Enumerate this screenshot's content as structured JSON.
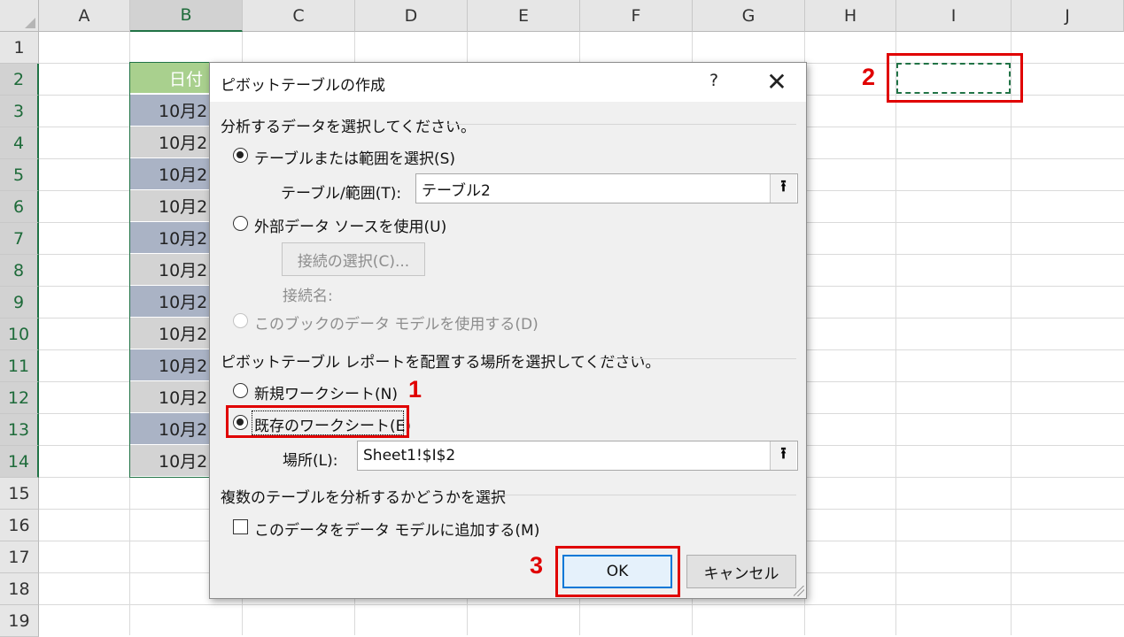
{
  "sheet": {
    "columns": [
      "A",
      "B",
      "C",
      "D",
      "E",
      "F",
      "G",
      "H",
      "I",
      "J"
    ],
    "rows": [
      "1",
      "2",
      "3",
      "4",
      "5",
      "6",
      "7",
      "8",
      "9",
      "10",
      "11",
      "12",
      "13",
      "14",
      "15",
      "16",
      "17",
      "18",
      "19"
    ],
    "table_header": "日付",
    "table_cells": [
      "10月2",
      "10月2",
      "10月2",
      "10月2",
      "10月2",
      "10月2",
      "10月2",
      "10月2",
      "10月2",
      "10月2",
      "10月2",
      "10月2"
    ]
  },
  "dialog": {
    "title": "ピボットテーブルの作成",
    "help_label": "?",
    "close_label": "✕",
    "section1": "分析するデータを選択してください。",
    "opt_table": "テーブルまたは範囲を選択(S)",
    "table_range_label": "テーブル/範囲(T):",
    "table_range_value": "テーブル2",
    "opt_external": "外部データ ソースを使用(U)",
    "connection_button": "接続の選択(C)...",
    "connection_name_label": "接続名:",
    "opt_data_model": "このブックのデータ モデルを使用する(D)",
    "section2": "ピボットテーブル レポートを配置する場所を選択してください。",
    "opt_new_sheet": "新規ワークシート(N)",
    "opt_existing_sheet": "既存のワークシート(E)",
    "location_label": "場所(L):",
    "location_value": "Sheet1!$I$2",
    "section3": "複数のテーブルを分析するかどうかを選択",
    "add_to_model": "このデータをデータ モデルに追加する(M)",
    "ok_label": "OK",
    "cancel_label": "キャンセル",
    "range_button_icon": "⭱"
  },
  "annotations": {
    "step1": "1",
    "step2": "2",
    "step3": "3"
  },
  "colors": {
    "accent": "#217346",
    "annotation": "#e00000",
    "table_header": "#a9d08e"
  }
}
